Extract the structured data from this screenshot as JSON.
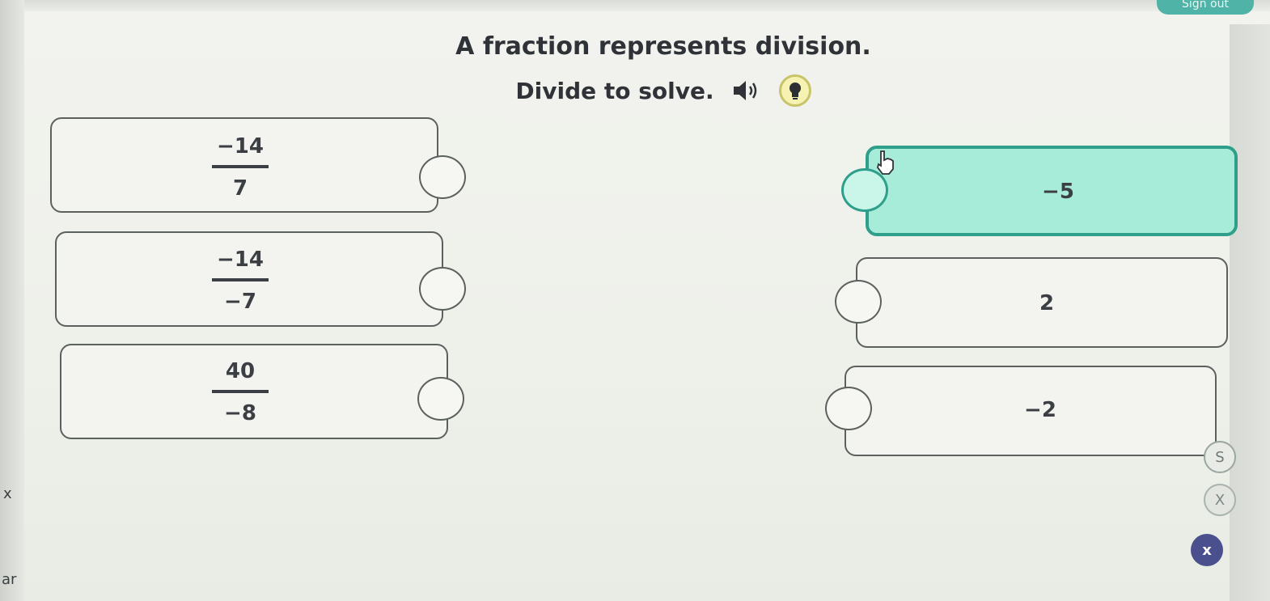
{
  "header": {
    "signout_label": "Sign out"
  },
  "prompt": {
    "title": "A fraction represents division.",
    "instruction": "Divide to solve."
  },
  "left_items": [
    {
      "numerator": "−14",
      "denominator": "7"
    },
    {
      "numerator": "−14",
      "denominator": "−7"
    },
    {
      "numerator": "40",
      "denominator": "−8"
    }
  ],
  "right_items": [
    {
      "value": "−5",
      "selected": true
    },
    {
      "value": "2",
      "selected": false
    },
    {
      "value": "−2",
      "selected": false
    }
  ],
  "side_tools": [
    {
      "label": "S"
    },
    {
      "label": "X"
    },
    {
      "label": "x"
    }
  ],
  "colors": {
    "selected_fill": "#a7ecd9",
    "selected_border": "#2f9f8b",
    "hint_fill": "#f6f2b2"
  },
  "icons": {
    "speaker": "speaker-icon",
    "hint": "lightbulb-icon",
    "cursor": "hand-pointer-icon"
  }
}
